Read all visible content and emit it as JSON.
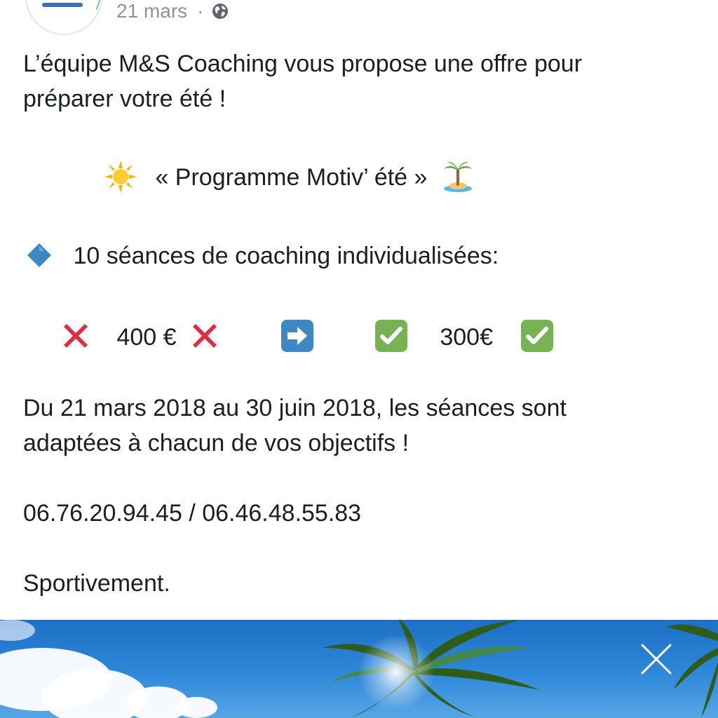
{
  "post": {
    "date": "21 mars",
    "separator": "·",
    "privacy_icon": "globe-icon",
    "intro_line1": "L’équipe M&S Coaching vous propose une offre pour",
    "intro_line2": "préparer votre été !",
    "program_title": "« Programme Motiv’ été »",
    "program_icons": [
      "sun-icon",
      "desert-island-icon"
    ],
    "sessions_bullet_icon": "blue-diamond-icon",
    "sessions_text": "10 séances de coaching individualisées:",
    "old_price": "400 €",
    "new_price": "300€",
    "price_icons": [
      "cross-mark-icon",
      "right-arrow-icon",
      "check-mark-icon"
    ],
    "dates_line1": "Du 21 mars 2018 au 30 juin 2018, les séances sont",
    "dates_line2": "adaptées à chacun de vos objectifs !",
    "phones": "06.76.20.94.45 / 06.46.48.55.83",
    "signoff": "Sportivement."
  },
  "banner": {
    "close_icon": "close-icon"
  },
  "colors": {
    "text": "#1c1e21",
    "meta": "#8d949e",
    "cross": "#dd2e44",
    "check": "#77b255",
    "arrow_box": "#3b88c3",
    "diamond": "#3b88c3",
    "sky": "#2f88d8"
  }
}
